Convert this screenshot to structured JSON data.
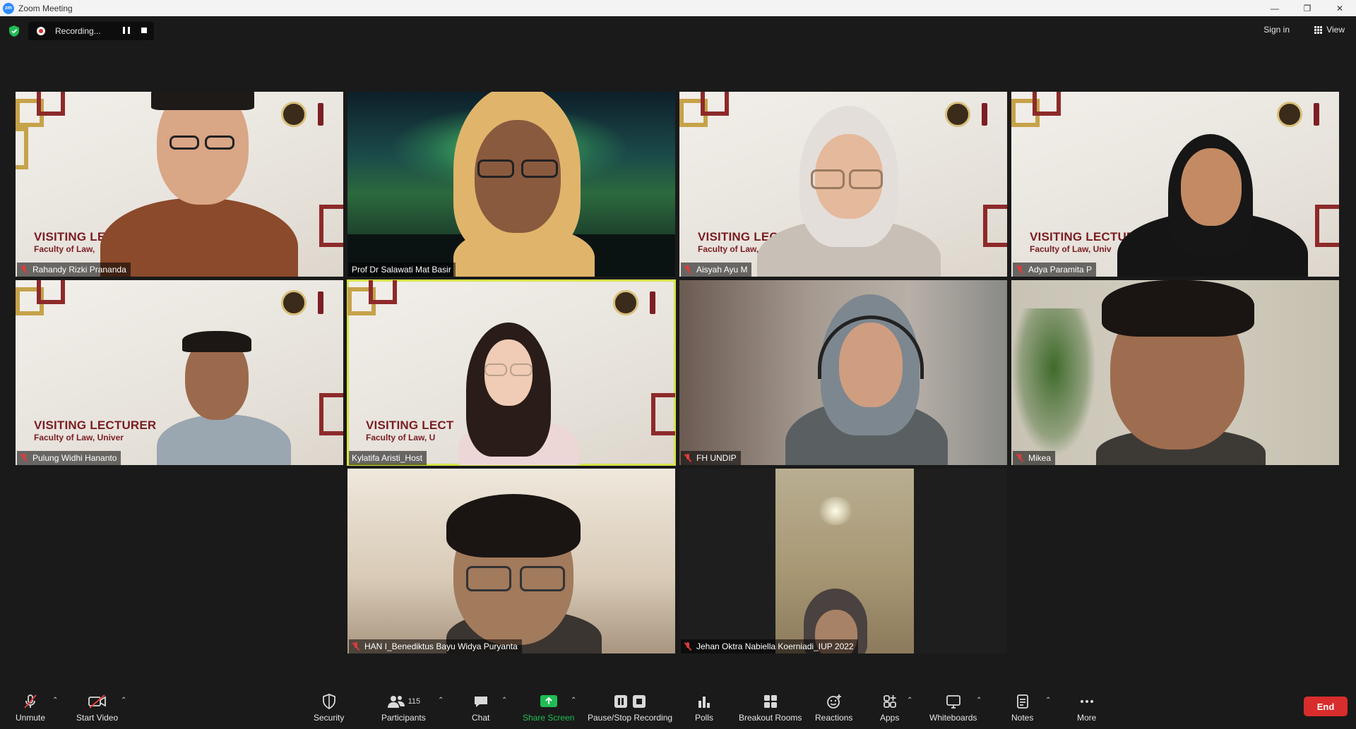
{
  "window": {
    "title": "Zoom Meeting",
    "app_icon": "zm"
  },
  "topbar": {
    "recording_label": "Recording...",
    "sign_in": "Sign in",
    "view": "View"
  },
  "participants": [
    {
      "name": "Rahandy Rizki Prananda",
      "muted": true,
      "banner_title": "VISITING LE",
      "banner_sub": "Faculty of Law,"
    },
    {
      "name": "Prof Dr Salawati Mat Basir",
      "muted": false
    },
    {
      "name": "Aisyah Ayu M",
      "muted": true,
      "banner_title": "VISITING LECT",
      "banner_sub": "Faculty of Law,"
    },
    {
      "name": "Adya Paramita P",
      "muted": true,
      "banner_title": "VISITING LECTURE",
      "banner_sub": "Faculty of Law, Univ"
    },
    {
      "name": "Pulung Widhi Hananto",
      "muted": true,
      "banner_title": "VISITING LECTURER",
      "banner_sub": "Faculty of Law, Univer"
    },
    {
      "name": "Kylatifa Aristi_Host",
      "muted": false,
      "banner_title": "VISITING LECT",
      "banner_sub": "Faculty of Law, U"
    },
    {
      "name": "FH UNDIP",
      "muted": true
    },
    {
      "name": "Mikea",
      "muted": true
    },
    {
      "name": "HAN I_Benediktus Bayu Widya Puryanta",
      "muted": true
    },
    {
      "name": "Jehan Oktra Nabiella Koerniadi_IUP 2022",
      "muted": true
    }
  ],
  "toolbar": {
    "unmute": "Unmute",
    "start_video": "Start Video",
    "security": "Security",
    "participants": "Participants",
    "participants_count": "115",
    "chat": "Chat",
    "share_screen": "Share Screen",
    "pause_stop_recording": "Pause/Stop Recording",
    "polls": "Polls",
    "breakout_rooms": "Breakout Rooms",
    "reactions": "Reactions",
    "apps": "Apps",
    "whiteboards": "Whiteboards",
    "notes": "Notes",
    "more": "More",
    "end": "End"
  },
  "colors": {
    "background": "#1a1a1a",
    "active_speaker_border": "#d6e34a",
    "share_green": "#1fbd53",
    "end_red": "#d92c2c",
    "muted_red": "#e03c3c"
  }
}
